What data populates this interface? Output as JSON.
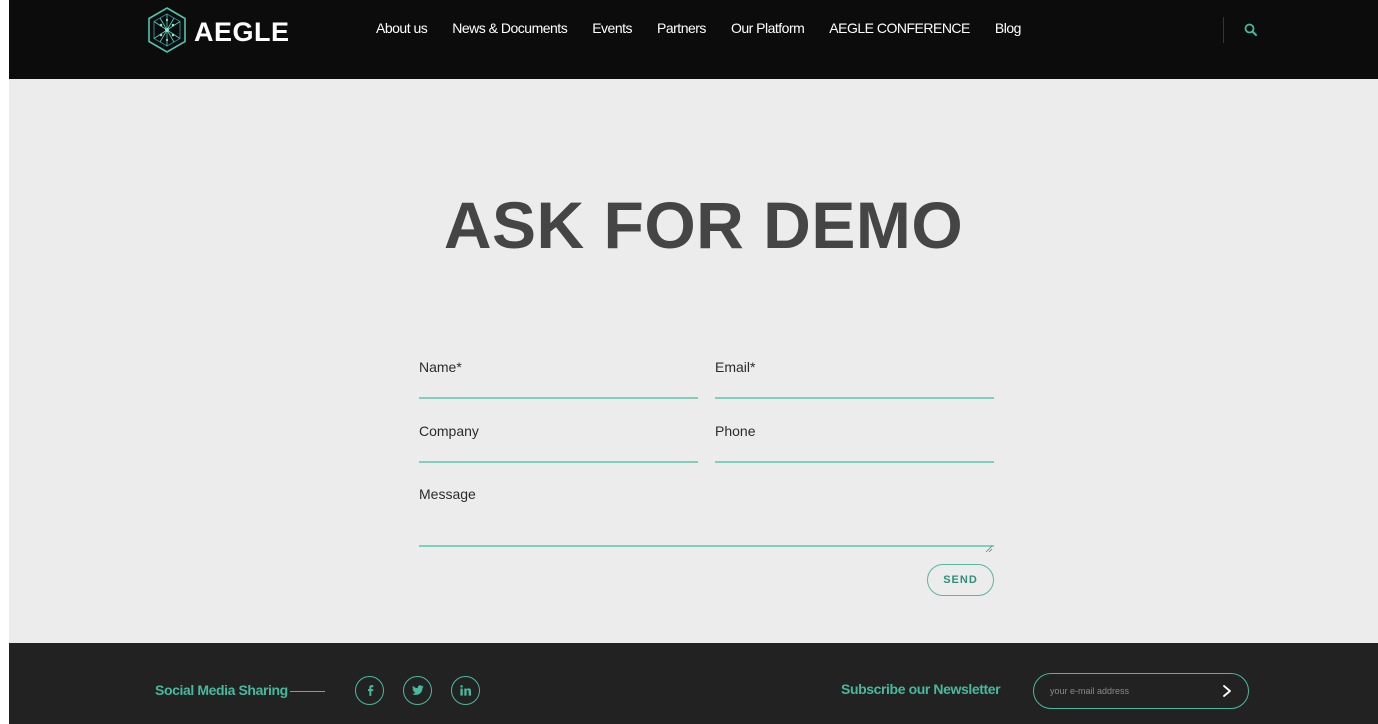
{
  "header": {
    "logo_text": "AEGLE",
    "nav": [
      {
        "label": "About us"
      },
      {
        "label": "News & Documents"
      },
      {
        "label": "Events"
      },
      {
        "label": "Partners"
      },
      {
        "label": "Our Platform"
      },
      {
        "label": "AEGLE CONFERENCE"
      },
      {
        "label": "Blog"
      }
    ],
    "search_icon": "search-icon"
  },
  "main": {
    "title": "ASK FOR DEMO",
    "form": {
      "name_label": "Name*",
      "email_label": "Email*",
      "company_label": "Company",
      "phone_label": "Phone",
      "message_label": "Message",
      "send_label": "SEND"
    }
  },
  "footer": {
    "social_label": "Social Media Sharing",
    "social_icons": [
      "facebook-icon",
      "twitter-icon",
      "linkedin-icon"
    ],
    "newsletter_label": "Subscribe our Newsletter",
    "newsletter_placeholder": "your e-mail address"
  },
  "colors": {
    "header_bg": "#0c0c0c",
    "main_bg": "#ececec",
    "footer_bg": "#222222",
    "accent": "#46b99f",
    "title": "#454545"
  }
}
